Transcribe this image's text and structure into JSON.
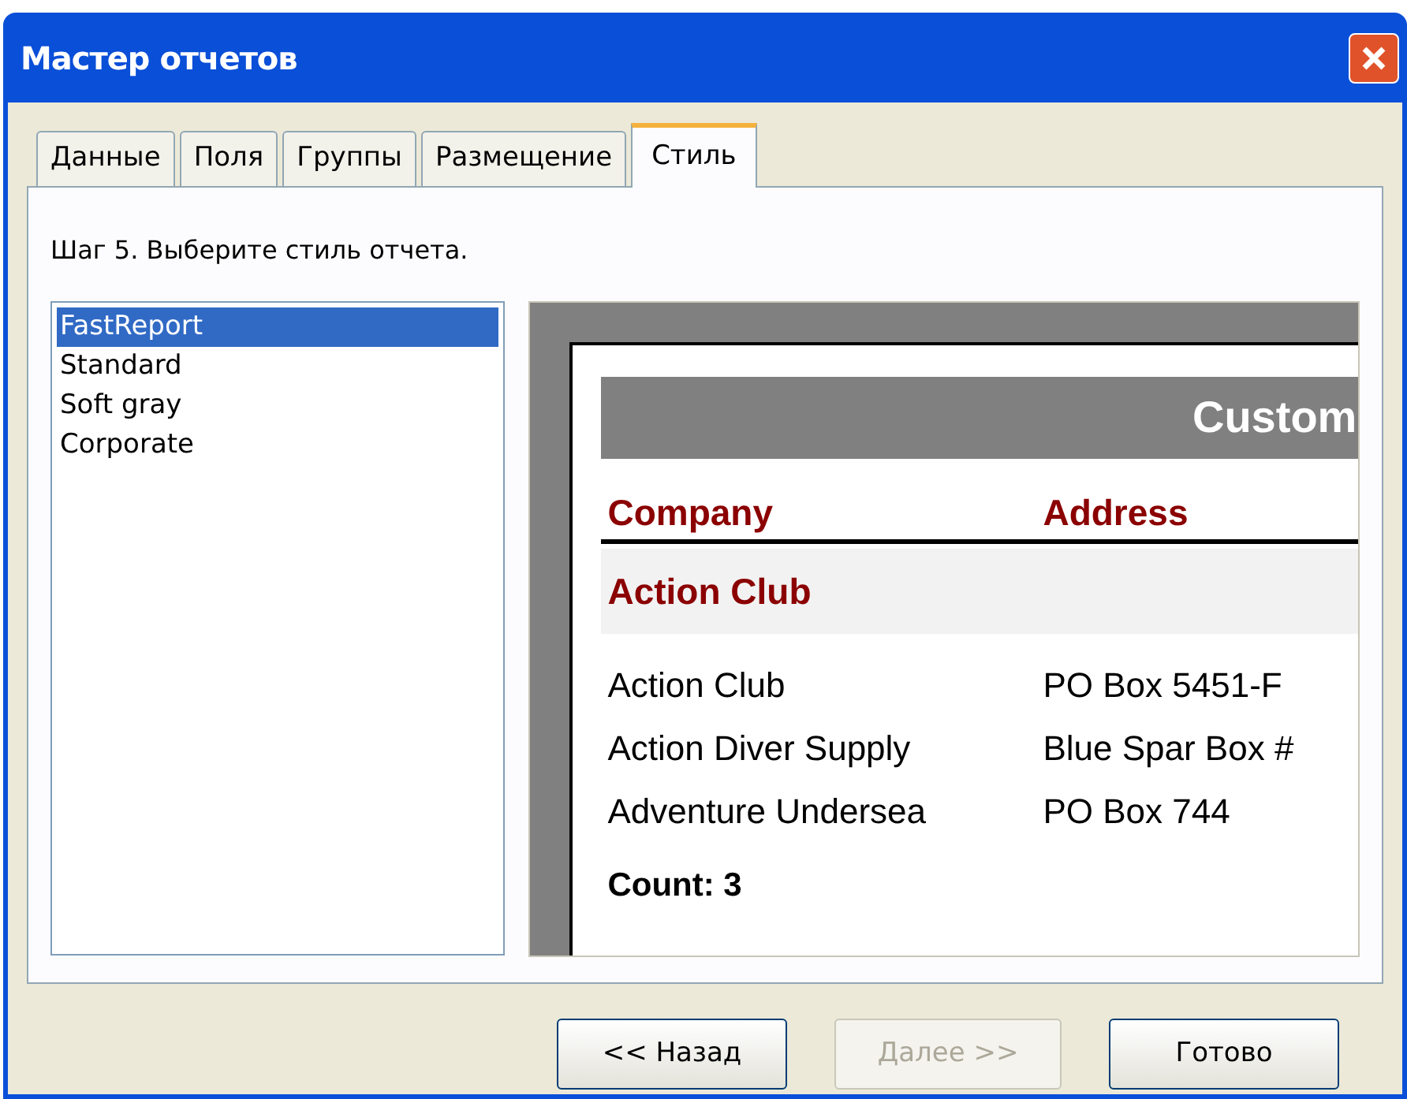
{
  "window": {
    "title": "Мастер отчетов"
  },
  "tabs": [
    {
      "label": "Данные",
      "selected": false
    },
    {
      "label": "Поля",
      "selected": false
    },
    {
      "label": "Группы",
      "selected": false
    },
    {
      "label": "Размещение",
      "selected": false
    },
    {
      "label": "Стиль",
      "selected": true
    }
  ],
  "step_text": "Шаг 5. Выберите стиль отчета.",
  "styles": [
    {
      "label": "FastReport",
      "selected": true
    },
    {
      "label": "Standard",
      "selected": false
    },
    {
      "label": "Soft gray",
      "selected": false
    },
    {
      "label": "Corporate",
      "selected": false
    }
  ],
  "preview": {
    "title": "Custom",
    "columns": [
      "Company",
      "Address"
    ],
    "group": "Action Club",
    "rows": [
      [
        "Action Club",
        "PO Box 5451-F"
      ],
      [
        "Action Diver Supply",
        "Blue Spar Box #"
      ],
      [
        "Adventure Undersea",
        "PO Box 744"
      ]
    ],
    "footer": "Count: 3"
  },
  "buttons": [
    {
      "label": "<< Назад",
      "disabled": false
    },
    {
      "label": "Далее >>",
      "disabled": true
    },
    {
      "label": "Готово",
      "disabled": false
    }
  ]
}
